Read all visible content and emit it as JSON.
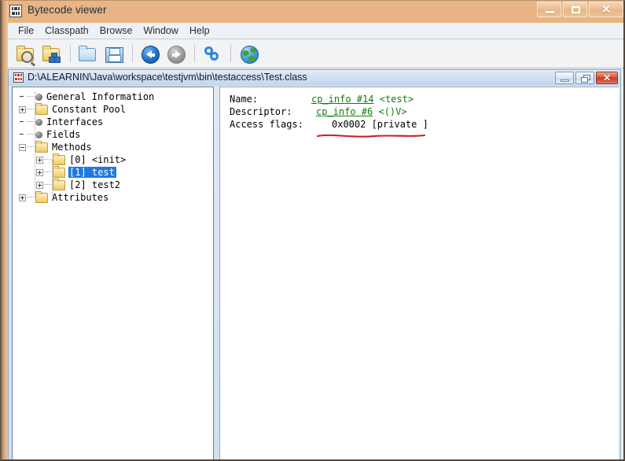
{
  "window": {
    "title": "Bytecode viewer",
    "icon": "bytecode-app-icon",
    "controls": {
      "minimize": "minimize",
      "maximize": "maximize",
      "close": "close"
    }
  },
  "menubar": {
    "items": [
      {
        "label": "File"
      },
      {
        "label": "Classpath"
      },
      {
        "label": "Browse"
      },
      {
        "label": "Window"
      },
      {
        "label": "Help"
      }
    ]
  },
  "toolbar": {
    "buttons": [
      {
        "name": "open-class-file-icon",
        "tooltip": "Open class file"
      },
      {
        "name": "open-from-classpath-icon",
        "tooltip": "Open from classpath"
      },
      {
        "name": "browse-classpath-icon",
        "tooltip": "Browse classpath"
      },
      {
        "name": "save-icon",
        "tooltip": "Save"
      },
      {
        "name": "back-icon",
        "tooltip": "Back"
      },
      {
        "name": "forward-icon",
        "tooltip": "Forward"
      },
      {
        "name": "reload-icon",
        "tooltip": "Reload"
      },
      {
        "name": "globe-icon",
        "tooltip": "Browse internet"
      }
    ]
  },
  "child_window": {
    "title": "D:\\ALEARNIN\\Java\\workspace\\testjvm\\bin\\testaccess\\Test.class",
    "icon": "class-file-icon",
    "controls": {
      "minimize": "minimize",
      "restore": "restore",
      "close": "close"
    }
  },
  "tree": {
    "nodes": [
      {
        "label": "General Information",
        "icon": "bullet",
        "indent": 0,
        "expander": "none",
        "selected": false
      },
      {
        "label": "Constant Pool",
        "icon": "folder",
        "indent": 0,
        "expander": "plus",
        "selected": false
      },
      {
        "label": "Interfaces",
        "icon": "bullet",
        "indent": 0,
        "expander": "none",
        "selected": false
      },
      {
        "label": "Fields",
        "icon": "bullet",
        "indent": 0,
        "expander": "none",
        "selected": false
      },
      {
        "label": "Methods",
        "icon": "folder",
        "indent": 0,
        "expander": "minus",
        "selected": false
      },
      {
        "label": "[0] <init>",
        "icon": "folder",
        "indent": 1,
        "expander": "plus",
        "selected": false
      },
      {
        "label": "[1] test",
        "icon": "folder",
        "indent": 1,
        "expander": "plus",
        "selected": true
      },
      {
        "label": "[2] test2",
        "icon": "folder",
        "indent": 1,
        "expander": "plus",
        "selected": false
      },
      {
        "label": "Attributes",
        "icon": "folder",
        "indent": 0,
        "expander": "plus",
        "selected": false
      }
    ]
  },
  "detail": {
    "rows": [
      {
        "label": "Name:",
        "link": "cp_info #14",
        "suffix": "<test>"
      },
      {
        "label": "Descriptor:",
        "link": "cp_info #6",
        "suffix": "<()V>"
      }
    ],
    "access_flags_label": "Access flags:",
    "access_flags_value": "0x0002 [private ]"
  },
  "annotation": {
    "type": "red-underline",
    "color": "#cc1f1f"
  },
  "colors": {
    "selection": "#1f7ae0",
    "link": "#117a11",
    "annotation": "#cc1f1f",
    "titlebar": "#e0a877"
  }
}
